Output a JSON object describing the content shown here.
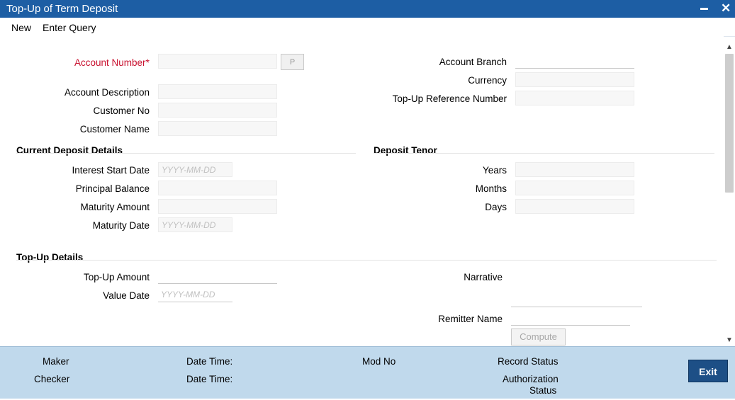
{
  "window": {
    "title": "Top-Up of Term Deposit"
  },
  "menu": {
    "items": [
      "New",
      "Enter Query"
    ]
  },
  "account": {
    "account_number_label": "Account Number",
    "required_mark": "*",
    "p_button": "P",
    "account_description_label": "Account Description",
    "customer_no_label": "Customer No",
    "customer_name_label": "Customer Name",
    "account_branch_label": "Account Branch",
    "currency_label": "Currency",
    "topup_reference_label": "Top-Up Reference Number"
  },
  "current_deposit": {
    "title": "Current Deposit Details",
    "interest_start_date_label": "Interest Start Date",
    "principal_balance_label": "Principal Balance",
    "maturity_amount_label": "Maturity Amount",
    "maturity_date_label": "Maturity Date"
  },
  "deposit_tenor": {
    "title": "Deposit Tenor",
    "years_label": "Years",
    "months_label": "Months",
    "days_label": "Days"
  },
  "topup": {
    "title": "Top-Up Details",
    "amount_label": "Top-Up Amount",
    "value_date_label": "Value Date",
    "narrative_label": "Narrative",
    "remitter_name_label": "Remitter Name",
    "compute_button": "Compute"
  },
  "date_placeholder": "YYYY-MM-DD",
  "footer": {
    "maker": "Maker",
    "checker": "Checker",
    "date_time_1": "Date Time:",
    "date_time_2": "Date Time:",
    "mod_no": "Mod No",
    "record_status": "Record Status",
    "authorization_status_line1": "Authorization",
    "authorization_status_line2": "Status",
    "exit_button": "Exit"
  },
  "colors": {
    "title_bar": "#1d5ea4",
    "footer": "#c0d9ec",
    "required": "#c8102e",
    "exit_button": "#1d4f86"
  }
}
